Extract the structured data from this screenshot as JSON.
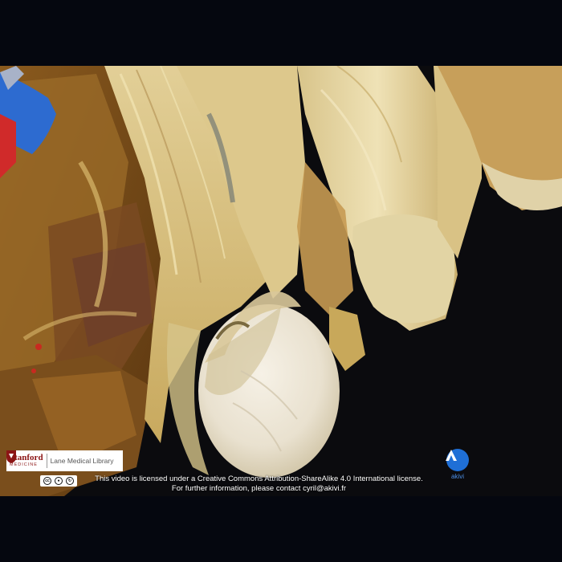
{
  "branding": {
    "institution_name": "Stanford",
    "institution_sub": "MEDICINE",
    "library_name": "Lane Medical Library",
    "producer_name": "akivi",
    "producer_color": "#1f6fd6",
    "institution_color": "#8c1515"
  },
  "license": {
    "line1": "This video is licensed under a Creative Commons Attribution-ShareAlike 4.0 International license.",
    "line2": "For further information, please contact cyril@akivi.fr",
    "cc_icons": [
      "cc",
      "by",
      "sa"
    ]
  },
  "icons": {
    "institution_logo": "shield-icon",
    "license_logo": "creative-commons-icon",
    "producer_logo": "akivi-icon"
  }
}
